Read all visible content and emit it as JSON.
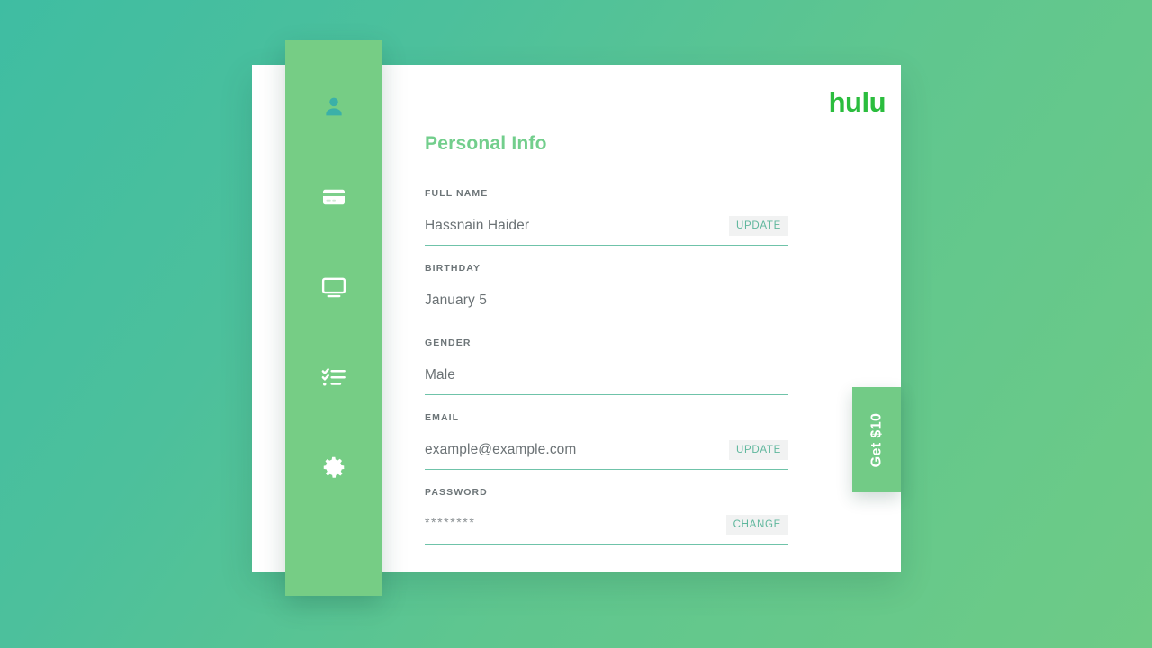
{
  "brand": {
    "logo_text": "hulu"
  },
  "sidebar": {
    "background_color": "#76cd85",
    "items": [
      {
        "icon": "user-icon",
        "name": "profile",
        "active": true
      },
      {
        "icon": "credit-card-icon",
        "name": "billing",
        "active": false
      },
      {
        "icon": "tv-icon",
        "name": "devices",
        "active": false
      },
      {
        "icon": "checklist-icon",
        "name": "watchlist",
        "active": false
      },
      {
        "icon": "gear-icon",
        "name": "settings",
        "active": false
      }
    ]
  },
  "main": {
    "page_title": "Personal Info",
    "accent_color": "#72ce8c",
    "underline_color": "#6fc3a9",
    "fields": [
      {
        "label": "FULL NAME",
        "value": "Hassnain Haider",
        "action": "UPDATE",
        "has_action": true,
        "masked": false
      },
      {
        "label": "BIRTHDAY",
        "value": "January 5",
        "action": "",
        "has_action": false,
        "masked": false
      },
      {
        "label": "GENDER",
        "value": "Male",
        "action": "",
        "has_action": false,
        "masked": false
      },
      {
        "label": "EMAIL",
        "value": "example@example.com",
        "action": "UPDATE",
        "has_action": true,
        "masked": false
      },
      {
        "label": "PASSWORD",
        "value": "********",
        "action": "CHANGE",
        "has_action": true,
        "masked": true
      }
    ]
  },
  "promo_tab": {
    "label": "Get $10",
    "color": "#72cb86"
  }
}
